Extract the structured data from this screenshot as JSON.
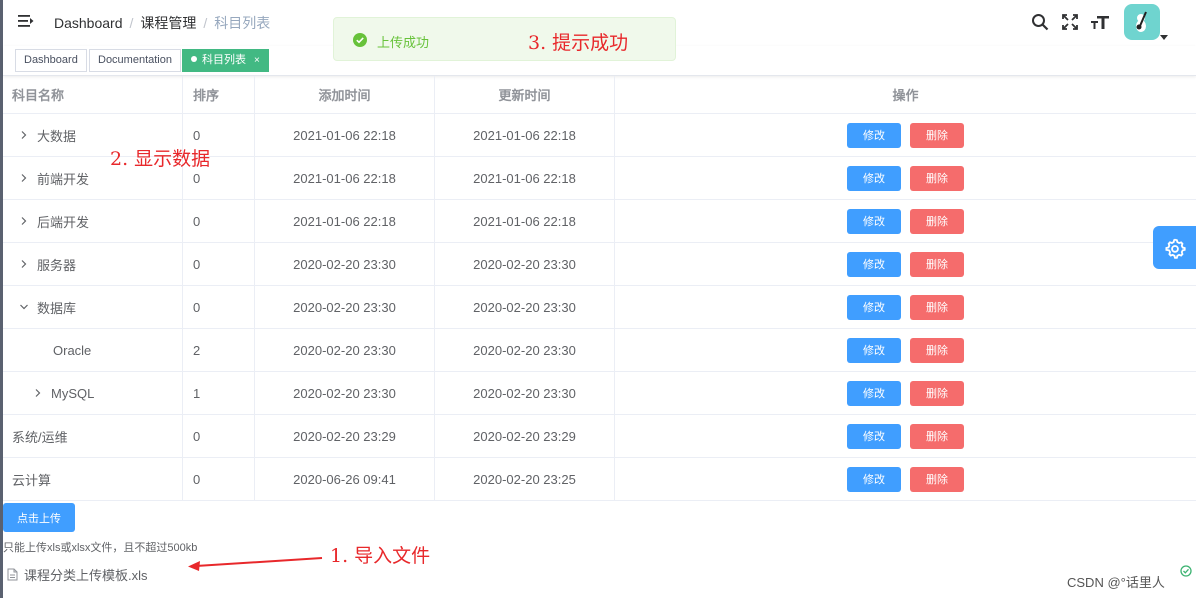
{
  "breadcrumb": [
    "Dashboard",
    "课程管理",
    "科目列表"
  ],
  "tags": [
    {
      "label": "Dashboard",
      "active": false
    },
    {
      "label": "Documentation",
      "active": false
    },
    {
      "label": "科目列表",
      "active": true,
      "close": "×"
    }
  ],
  "toast": {
    "text": "上传成功"
  },
  "annotations": {
    "step1": "1. 导入文件",
    "step2": "2. 显示数据",
    "step3": "3. 提示成功"
  },
  "table": {
    "headers": [
      "科目名称",
      "排序",
      "添加时间",
      "更新时间",
      "操作"
    ],
    "rows": [
      {
        "name": "大数据",
        "sort": "0",
        "created": "2021-01-06 22:18",
        "updated": "2021-01-06 22:18"
      },
      {
        "name": "前端开发",
        "sort": "0",
        "created": "2021-01-06 22:18",
        "updated": "2021-01-06 22:18"
      },
      {
        "name": "后端开发",
        "sort": "0",
        "created": "2021-01-06 22:18",
        "updated": "2021-01-06 22:18"
      },
      {
        "name": "服务器",
        "sort": "0",
        "created": "2020-02-20 23:30",
        "updated": "2020-02-20 23:30"
      },
      {
        "name": "数据库",
        "sort": "0",
        "created": "2020-02-20 23:30",
        "updated": "2020-02-20 23:30"
      },
      {
        "name": "Oracle",
        "sort": "2",
        "created": "2020-02-20 23:30",
        "updated": "2020-02-20 23:30"
      },
      {
        "name": "MySQL",
        "sort": "1",
        "created": "2020-02-20 23:30",
        "updated": "2020-02-20 23:30"
      },
      {
        "name": "系统/运维",
        "sort": "0",
        "created": "2020-02-20 23:29",
        "updated": "2020-02-20 23:29"
      },
      {
        "name": "云计算",
        "sort": "0",
        "created": "2020-06-26 09:41",
        "updated": "2020-02-20 23:25"
      }
    ],
    "edit_label": "修改",
    "delete_label": "删除"
  },
  "upload": {
    "button_label": "点击上传",
    "tip": "只能上传xls或xlsx文件，且不超过500kb",
    "file_name": "课程分类上传模板.xls"
  },
  "watermark": "CSDN @°话里人",
  "colors": {
    "primary": "#409eff",
    "danger": "#f56c6c",
    "success": "#67c23a",
    "tag_active": "#42b983",
    "annotation": "#e8282b"
  }
}
